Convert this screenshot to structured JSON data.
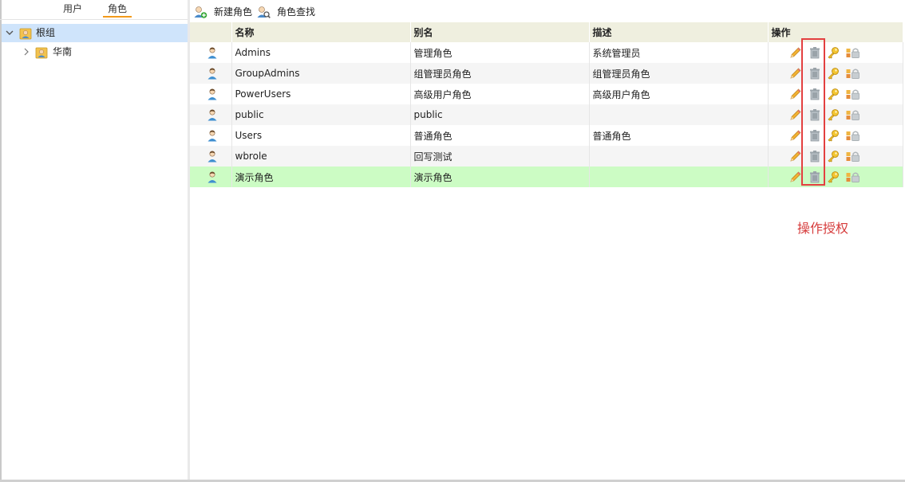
{
  "left_tabs": [
    {
      "label": "用户",
      "active": false
    },
    {
      "label": "角色",
      "active": true
    }
  ],
  "tree": {
    "root": {
      "label": "根组",
      "expanded": true,
      "selected": true
    },
    "children": [
      {
        "label": "华南",
        "expanded": false
      }
    ]
  },
  "toolbar": {
    "new_role_label": "新建角色",
    "find_role_label": "角色查找"
  },
  "table": {
    "columns": [
      "名称",
      "别名",
      "描述",
      "操作"
    ],
    "rows": [
      {
        "name": "Admins",
        "alias": "管理角色",
        "desc": "系统管理员"
      },
      {
        "name": "GroupAdmins",
        "alias": "组管理员角色",
        "desc": "组管理员角色"
      },
      {
        "name": "PowerUsers",
        "alias": "高级用户角色",
        "desc": "高级用户角色"
      },
      {
        "name": "public",
        "alias": "public",
        "desc": ""
      },
      {
        "name": "Users",
        "alias": "普通角色",
        "desc": "普通角色"
      },
      {
        "name": "wbrole",
        "alias": "回写测试",
        "desc": ""
      },
      {
        "name": "演示角色",
        "alias": "演示角色",
        "desc": "",
        "highlighted": true
      }
    ]
  },
  "annotation": {
    "label": "操作授权",
    "color": "#e34040"
  },
  "colors": {
    "selected_tree_bg": "#cfe4fb",
    "header_bg": "#efefdf",
    "highlight_row_bg": "#ccfcc4",
    "tab_accent": "#f39a1a"
  },
  "icons": [
    "user-folder-icon",
    "add-role-icon",
    "search-role-icon",
    "role-user-icon",
    "edit-pencil-icon",
    "delete-trash-icon",
    "authorize-key-icon",
    "permission-lock-icon"
  ]
}
